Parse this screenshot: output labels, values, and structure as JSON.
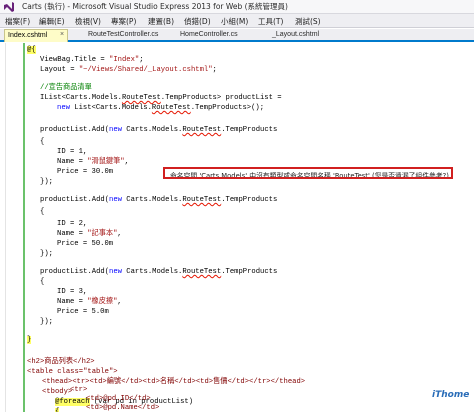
{
  "window": {
    "title": "Carts (執行) - Microsoft Visual Studio Express 2013 for Web (系統管理員)"
  },
  "menu": [
    "檔案(F)",
    "編輯(E)",
    "檢視(V)",
    "專案(P)",
    "建置(B)",
    "偵錯(D)",
    "小組(M)",
    "工具(T)",
    "測試(S)"
  ],
  "tabs": [
    {
      "label": "Index.cshtml",
      "active": true,
      "close": "×"
    },
    {
      "label": "RouteTestController.cs",
      "active": false
    },
    {
      "label": "HomeController.cs",
      "active": false
    },
    {
      "label": "_Layout.cshtml",
      "active": false
    }
  ],
  "code": {
    "razor_open": "@{",
    "l1a": "ViewBag.Title = ",
    "l1b": "\"Index\"",
    "l1c": ";",
    "l2a": "Layout = ",
    "l2b": "\"~/Views/Shared/_Layout.cshtml\"",
    "l2c": ";",
    "comment": "//宣告商品清單",
    "l4a": "IList<Carts.Models.",
    "l4b": "RouteTest",
    "l4c": ".TempProducts> productList =",
    "l5a": "new",
    "l5b": " List<Carts.Models.",
    "l5c": "RouteTest",
    "l5d": ".TempProducts>();",
    "add1a": "productList.Add(",
    "add1b": "new",
    "add1c": " Carts.Models.",
    "add1d": "RouteTest",
    "add1e": ".TempProducts",
    "brace_open": "{",
    "id1": "ID = 1,",
    "name1a": "Name = ",
    "name1b": "\"滑鼠鍵筆\"",
    "name1c": ",",
    "price1": "Price = 30.0m",
    "brace_close": "});",
    "id2": "ID = 2,",
    "name2a": "Name = ",
    "name2b": "\"記事本\"",
    "name2c": ",",
    "price2": "Price = 50.0m",
    "id3": "ID = 3,",
    "name3a": "Name = ",
    "name3b": "\"橡皮擦\"",
    "name3c": ",",
    "price3": "Price = 5.0m",
    "close_block": "}",
    "h2": "<h2>商品列表</h2>",
    "table": "<table class=\"table\">",
    "thead": "<thead><tr><td>編號</td><td>名稱</td><td>售價</td></tr></thead>",
    "tbody": "<tbody>",
    "foreach_a": "@foreach",
    "foreach_b": " (var pd in productList)",
    "foreach_brace": "{",
    "tr": "<tr>",
    "td1": "<td>@pd.ID</td>",
    "td2": "<td>@pd.Name</td>"
  },
  "tooltip": "命名空間 'Carts.Models' 中沒有類型或命名空間名稱 'RouteTest' (您是否遺漏了組件參考?)",
  "watermark": {
    "main": "iThome",
    "sub": "iThome"
  },
  "colors": {
    "keyword": "#0000ff",
    "string": "#a31515",
    "comment": "#008000",
    "accent": "#007acc",
    "error": "#d12020"
  }
}
